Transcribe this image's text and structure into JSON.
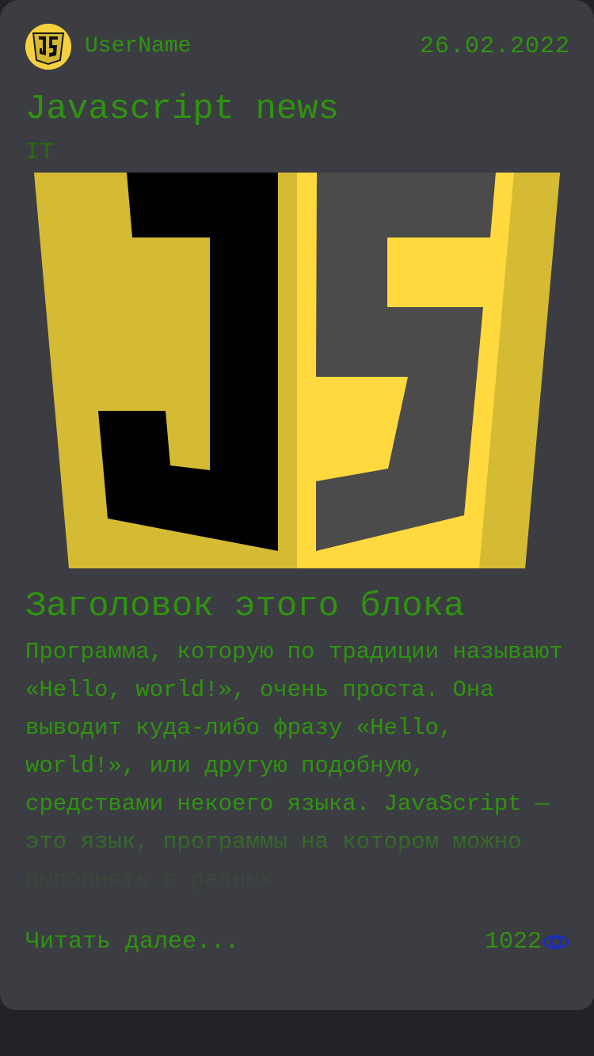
{
  "post": {
    "username": "UserName",
    "date": "26.02.2022",
    "title": "Javascript news",
    "category": "IT",
    "block_title": "Заголовок этого блока",
    "body": "Программа, которую по традиции называют «Hello, world!», очень проста. Она выводит куда-либо фразу «Hello, world!», или другую подобную, средствами некоего языка. JavaScript — это язык, программы на котором можно выполнять в разных",
    "read_more_label": "Читать далее...",
    "views": "1022"
  },
  "icons": {
    "avatar": "js-logo-icon",
    "hero": "js-shield-logo",
    "views": "eye-icon"
  },
  "colors": {
    "text_green": "#2f9310",
    "card_bg": "#3c3d42",
    "page_bg": "#222327",
    "js_yellow": "#f6d03f",
    "eye_blue": "#1c2fb5"
  }
}
